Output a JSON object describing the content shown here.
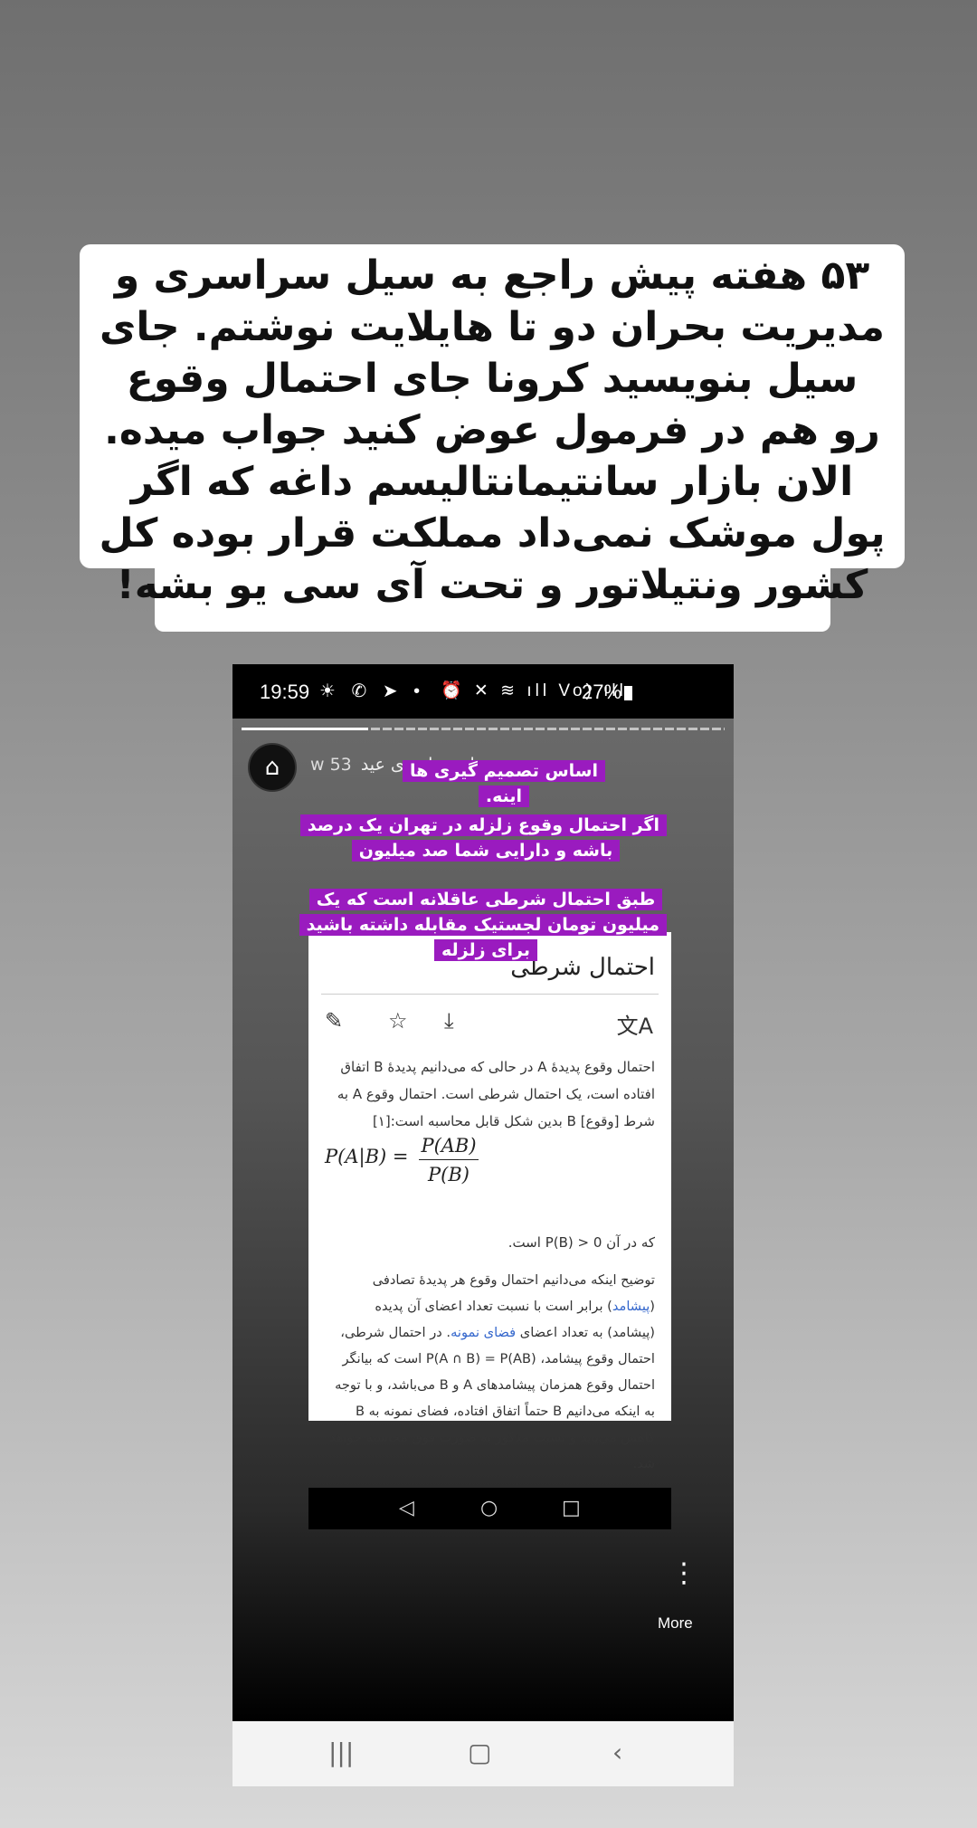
{
  "caption": {
    "text": "۵۳ هفته پیش راجع به سیل سراسری و مدیریت بحران دو تا هایلایت نوشتم. جای سیل بنویسید کرونا جای احتمال وقوع رو هم در فرمول عوض کنید جواب میده. الان بازار سانتیمانتالیسم داغه که اگر پول موشک نمی‌داد مملکت قرار بوده کل کشور ونتیلاتور و تحت آی سی یو بشه!"
  },
  "status_bar": {
    "time": "19:59",
    "left_icons": "☀ ✆ ➤ •",
    "right_icons": "⏰ ✕ ≋ ıll Vo) ıll",
    "battery": "27%"
  },
  "story": {
    "user": "سیل سراسری عید",
    "age": "53 w",
    "highlight_1": "اساس تصمیم گیری ها اینه.",
    "highlight_2": "اگر احتمال وقوع زلزله در تهران یک درصد باشه و دارایی شما صد میلیون",
    "highlight_3": "طبق احتمال شرطی عاقلانه است که یک میلیون تومان لجستیک مقابله داشته باشید برای زلزله",
    "more_label": "More"
  },
  "wiki": {
    "title": "احتمال شرطی",
    "para1": "احتمال وقوع پدیدهٔ A در حالی که می‌دانیم پدیدهٔ B اتفاق افتاده است، یک احتمال شرطی است. احتمال وقوع A به شرط [وقوع] B بدین شکل قابل محاسبه است:[۱]",
    "formula_lhs": "P(A|B) =",
    "formula_num": "P(AB)",
    "formula_den": "P(B)",
    "para2": "که در آن P(B) > 0 است.",
    "para3_a": "توضیح اینکه می‌دانیم احتمال وقوع هر پدیدهٔ تصادفی (",
    "para3_link1": "پیشامد",
    "para3_b": ") برابر است با نسبت تعداد اعضای آن پدیده (پیشامد) به تعداد اعضای ",
    "para3_link2": "فضای نمونه",
    "para3_c": ". در احتمال شرطی، احتمال وقوع پیشامد، P(A ∩ B) = P(AB) است که بیانگر احتمال وقوع همزمان پیشامدهای A و B می‌باشد، و با توجه به اینکه می‌دانیم B حتماً اتفاق افتاده، فضای نمونه به B کاهش می‌یابد و نسبت مذکور به صورت فوق محاسبه خواهد شد."
  },
  "icons": {
    "edit": "✎",
    "star": "☆",
    "download": "⤓",
    "translate": "文A",
    "back": "◁",
    "home": "○",
    "recents": "□",
    "bottom_recents": "|||",
    "bottom_home": "▢",
    "bottom_back": "‹",
    "more": "⋮",
    "avatar": "⌂"
  }
}
